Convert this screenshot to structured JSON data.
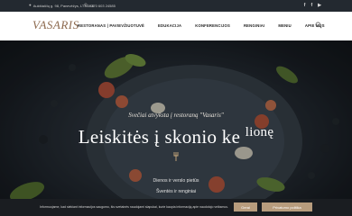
{
  "topbar": {
    "address": "Aukštaičių g. 98, Panevėžys, LT35116",
    "phone": "+370 603 24585",
    "icons": [
      "map-pin-icon",
      "phone-icon"
    ],
    "social": [
      {
        "name": "facebook-icon",
        "glyph": "f"
      },
      {
        "name": "facebook-icon",
        "glyph": "f"
      },
      {
        "name": "youtube-icon",
        "glyph": "▶"
      }
    ]
  },
  "header": {
    "logo": "VASARIS",
    "nav": [
      {
        "label": "RESTORANAS | PAVIEVŽIUOTUVĖ"
      },
      {
        "label": "EDUKACIJA"
      },
      {
        "label": "KONFERENCIJOS"
      },
      {
        "label": "RENGINIAI"
      },
      {
        "label": "MENIU"
      },
      {
        "label": "APIE MUS"
      }
    ],
    "search_icon": "search-icon"
  },
  "hero": {
    "subtitle": "Svečiai atvyksta į restoraną \"Vasaris\"",
    "title": "Leiskitės į skonio ke",
    "title_accent": "lionę",
    "line1": "Dienos ir verslo pietūs",
    "line2": "Šventės ir renginiai"
  },
  "cookie": {
    "text": "Informuojame, kad siekiant informacijos saugumo, šis svetainės naudojami slapukai, kurie kaupia informaciją apie naudotojo veiksmus.",
    "ok_label": "Gerai",
    "more_label": "Privatumo politika"
  },
  "colors": {
    "topbar_bg": "#232930",
    "logo": "#8d6a4f",
    "cookie_button": "#b79c7d"
  }
}
